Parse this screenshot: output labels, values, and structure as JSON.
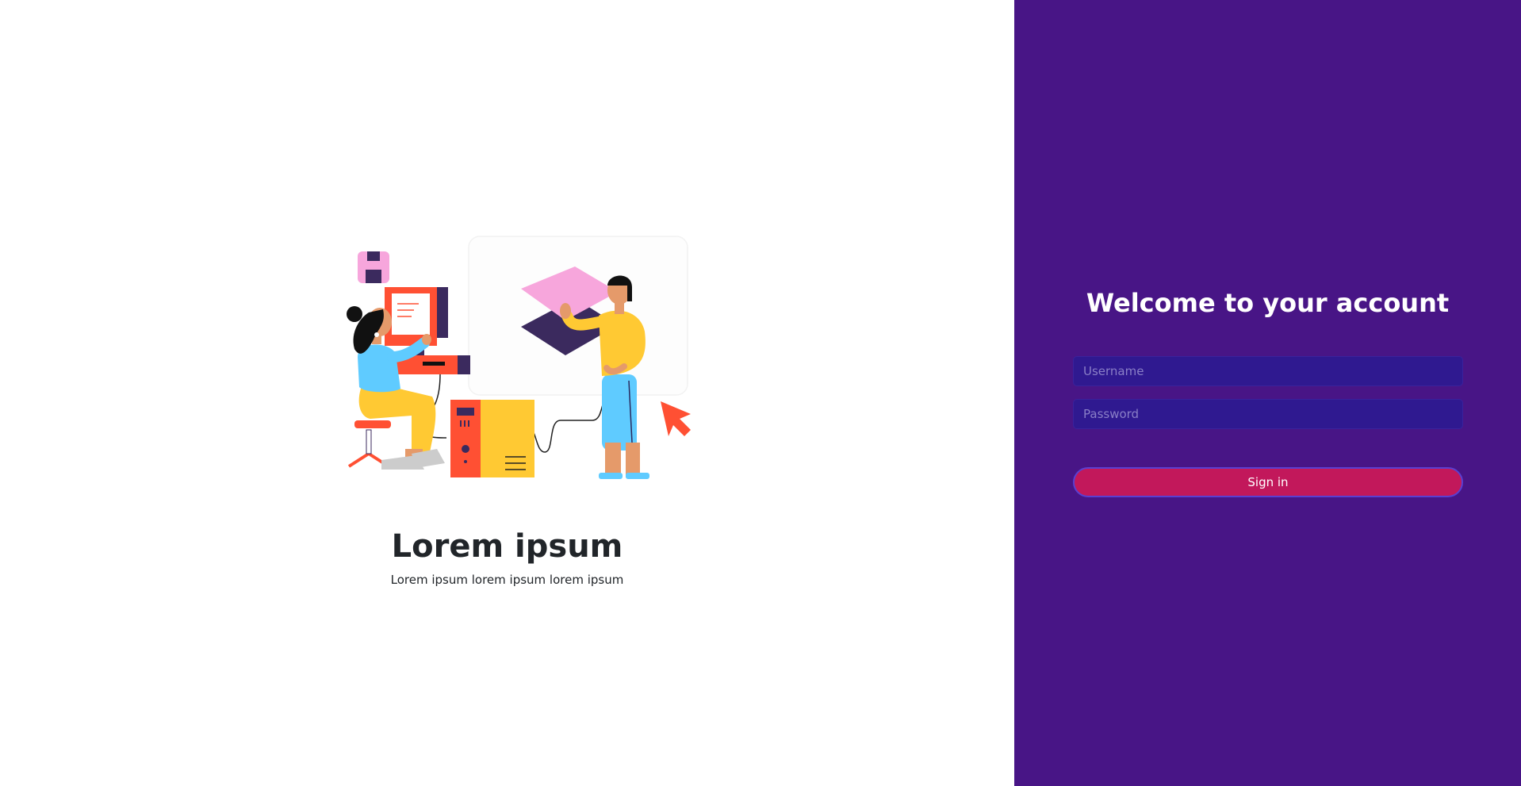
{
  "hero": {
    "title": "Lorem ipsum",
    "subtitle": "Lorem ipsum lorem ipsum lorem ipsum",
    "illustration_icon": "people-at-computer-illustration"
  },
  "login": {
    "title": "Welcome to your account",
    "username_placeholder": "Username",
    "password_placeholder": "Password",
    "signin_label": "Sign in"
  },
  "colors": {
    "panel_background": "#481586",
    "input_background": "#2f1990",
    "button_background": "#c2185b",
    "text_dark": "#212529"
  }
}
